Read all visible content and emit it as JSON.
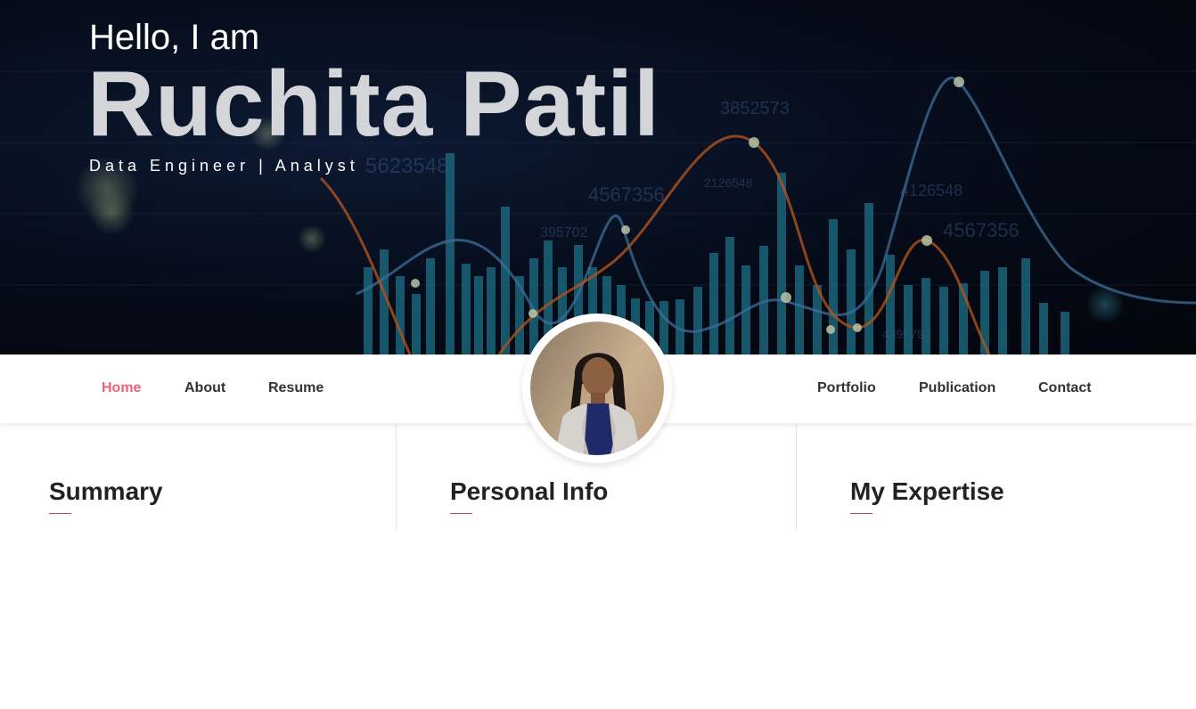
{
  "hero": {
    "greeting": "Hello, I am",
    "name": "Ruchita Patil",
    "role": "Data Engineer | Analyst",
    "background_numbers": [
      "3852573",
      "4126548",
      "5623548",
      "4567356",
      "395702",
      "2126548",
      "4567356",
      "4395792"
    ]
  },
  "nav": {
    "left": [
      {
        "label": "Home",
        "active": true
      },
      {
        "label": "About",
        "active": false
      },
      {
        "label": "Resume",
        "active": false
      }
    ],
    "right": [
      {
        "label": "Portfolio",
        "active": false
      },
      {
        "label": "Publication",
        "active": false
      },
      {
        "label": "Contact",
        "active": false
      }
    ],
    "active_color": "#e8637a"
  },
  "sections": [
    {
      "title": "Summary"
    },
    {
      "title": "Personal Info"
    },
    {
      "title": "My Expertise"
    }
  ],
  "colors": {
    "accent": "#c43c7a",
    "hero_bg": "#050b18"
  }
}
